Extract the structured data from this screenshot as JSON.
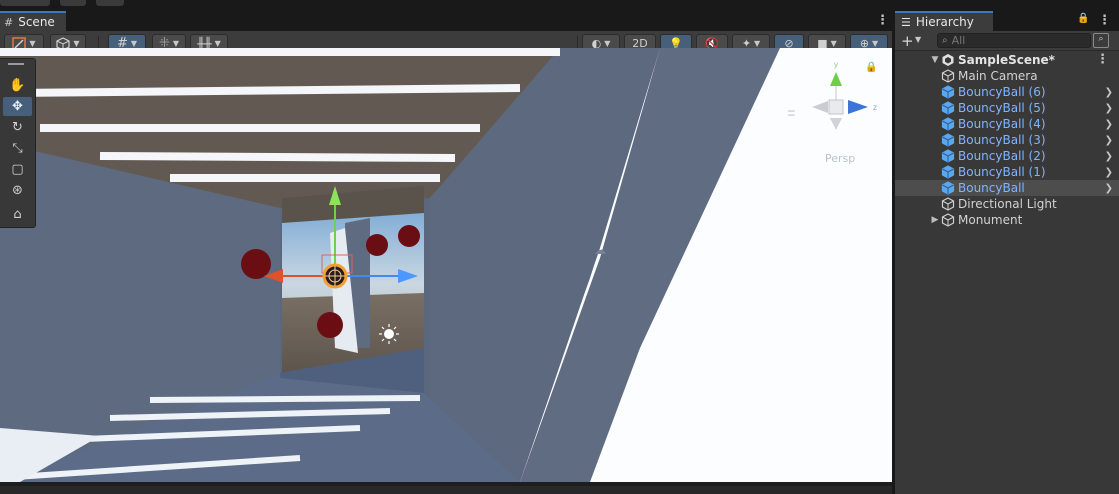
{
  "window": {
    "scene_tab": "Scene",
    "hierarchy_tab": "Hierarchy"
  },
  "scene_toolbar": {
    "view_2d_label": "2D",
    "persp_label": "Persp"
  },
  "hierarchy": {
    "search_placeholder": "All",
    "scene_name": "SampleScene*",
    "items": [
      {
        "label": "Main Camera",
        "type": "gameobject",
        "has_children": false
      },
      {
        "label": "BouncyBall (6)",
        "type": "prefab",
        "has_children": true
      },
      {
        "label": "BouncyBall (5)",
        "type": "prefab",
        "has_children": true
      },
      {
        "label": "BouncyBall (4)",
        "type": "prefab",
        "has_children": true
      },
      {
        "label": "BouncyBall (3)",
        "type": "prefab",
        "has_children": true
      },
      {
        "label": "BouncyBall (2)",
        "type": "prefab",
        "has_children": true
      },
      {
        "label": "BouncyBall (1)",
        "type": "prefab",
        "has_children": true
      },
      {
        "label": "BouncyBall",
        "type": "prefab",
        "has_children": true,
        "selected": true
      },
      {
        "label": "Directional Light",
        "type": "gameobject",
        "has_children": false
      },
      {
        "label": "Monument",
        "type": "gameobject",
        "has_children": true,
        "collapsed": true
      }
    ]
  },
  "colors": {
    "accent": "#3a79bb",
    "prefab_text": "#80b4ff",
    "active_button": "#46607c"
  }
}
